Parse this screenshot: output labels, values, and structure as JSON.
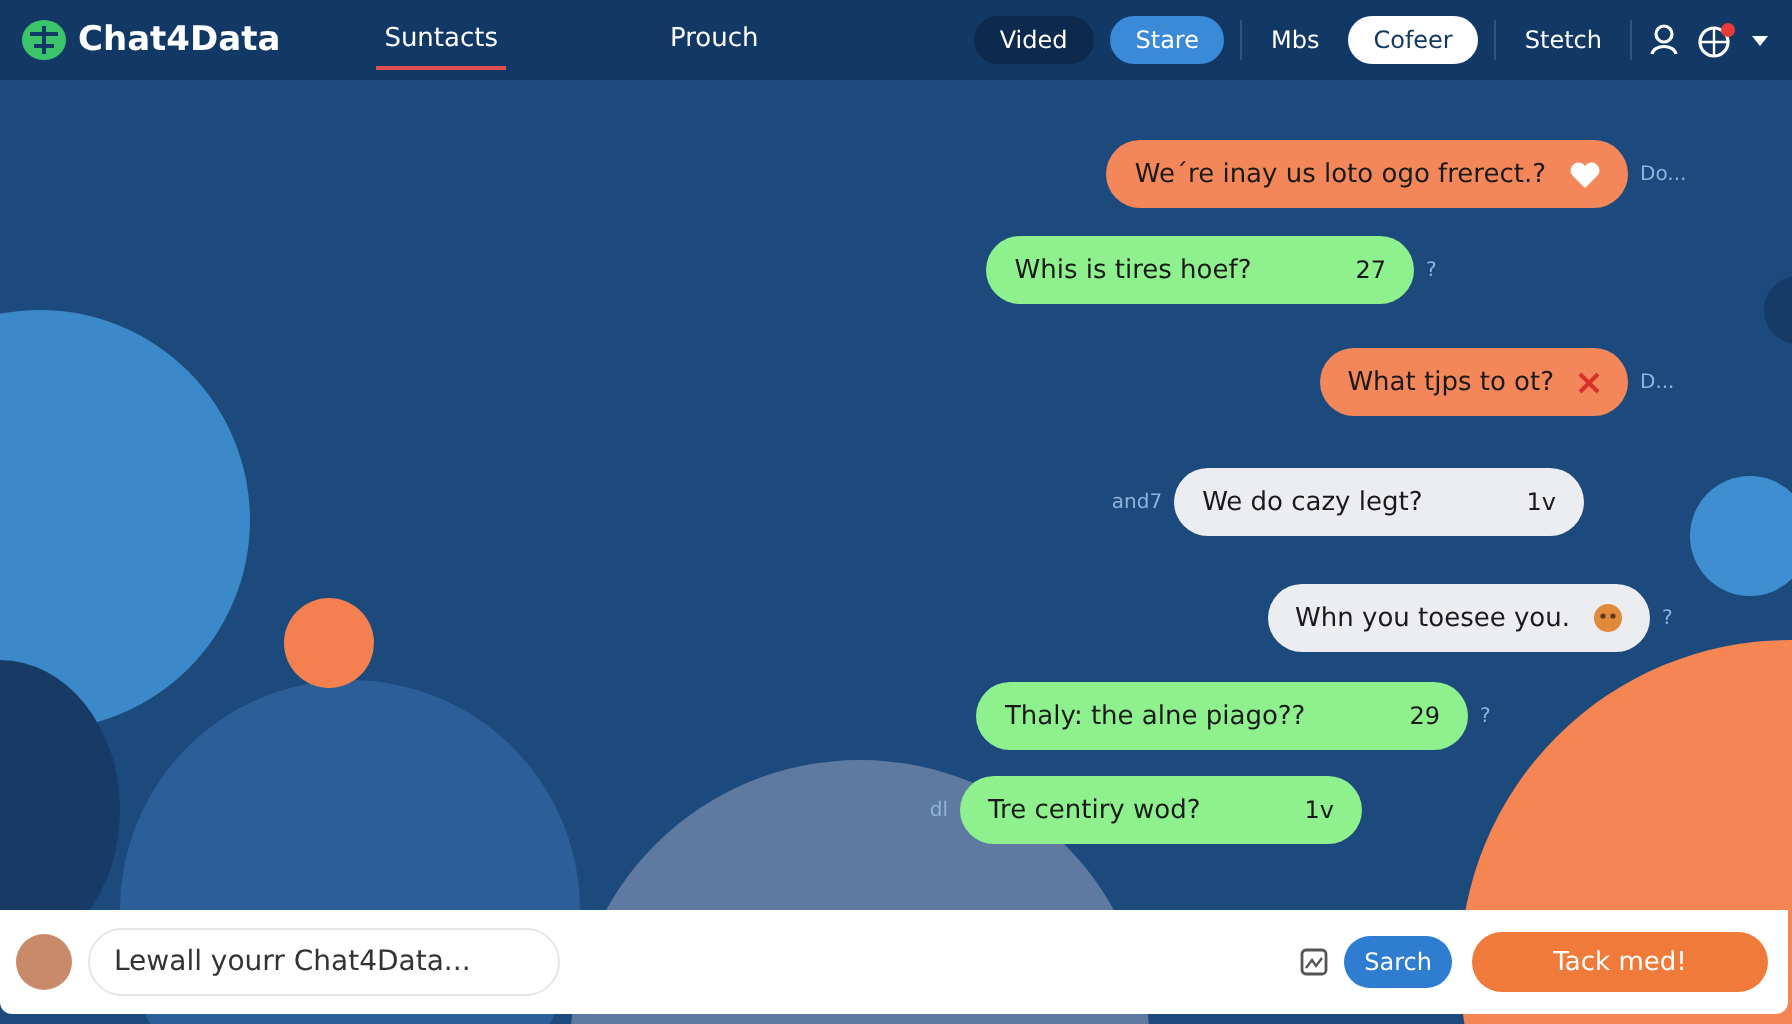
{
  "header": {
    "logo": "Chat4Data",
    "nav": [
      {
        "label": "Suntacts",
        "selected": true
      },
      {
        "label": "Prouch",
        "selected": false
      }
    ],
    "actions": [
      {
        "label": "Vided",
        "kind": "dark"
      },
      {
        "label": "Stare",
        "kind": "blue"
      },
      {
        "label": "Mbs",
        "kind": "plain"
      },
      {
        "label": "Cofeer",
        "kind": "white"
      },
      {
        "label": "Stetch",
        "kind": "plain"
      }
    ],
    "notification": true
  },
  "messages": [
    {
      "kind": "orange",
      "text": "We´re inay us loto ogo frerect.?",
      "side": "Do..."
    },
    {
      "kind": "green",
      "text": "Whis is tires hoef?",
      "meta": "27",
      "side": "?"
    },
    {
      "kind": "orange",
      "text": "What tjps to ot?",
      "side": "D..."
    },
    {
      "kind": "white",
      "text": "We do cazy legt?",
      "meta": "1v",
      "lead": "and7"
    },
    {
      "kind": "white",
      "text": "Whn you toesee you.",
      "side": "?"
    },
    {
      "kind": "green",
      "text": "Thaly: the alne piago??",
      "meta": "29",
      "side": "?"
    },
    {
      "kind": "green",
      "text": "Tre centiry wod?",
      "meta": "1v",
      "lead": "dl"
    }
  ],
  "composer": {
    "placeholder": "Lewall yourr Chat4Data...",
    "search": "Sarch",
    "send": "Tack med!"
  }
}
